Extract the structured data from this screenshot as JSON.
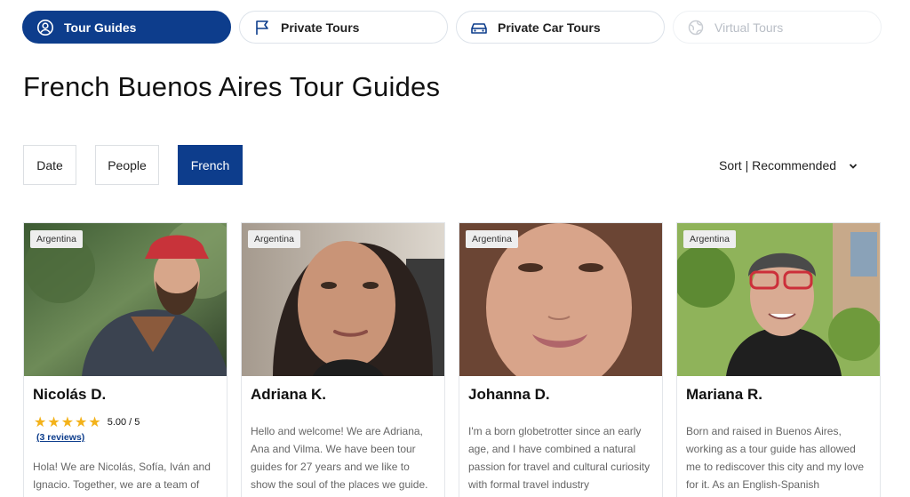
{
  "tabs": [
    {
      "label": "Tour Guides",
      "icon": "user-circle-icon",
      "active": true
    },
    {
      "label": "Private Tours",
      "icon": "flag-icon"
    },
    {
      "label": "Private Car Tours",
      "icon": "car-icon"
    },
    {
      "label": "Virtual Tours",
      "icon": "globe-icon",
      "disabled": true
    }
  ],
  "page_title": "French Buenos Aires Tour Guides",
  "filters": {
    "date": "Date",
    "people": "People",
    "language": "French"
  },
  "sort": {
    "label": "Sort | Recommended",
    "icon": "chevron-down-icon"
  },
  "colors": {
    "primary": "#0d3d8c",
    "star": "#f3b21a"
  },
  "guides": [
    {
      "country": "Argentina",
      "name": "Nicolás D.",
      "stars": "★★★★★",
      "rating": "5.00 / 5",
      "reviews": "(3 reviews)",
      "description": "Hola! We are Nicolás, Sofía, Iván and Ignacio. Together, we are a team of"
    },
    {
      "country": "Argentina",
      "name": "Adriana K.",
      "description": "Hello and welcome! We are Adriana, Ana and Vilma. We have been tour guides for 27 years and we like to show the soul of the places we guide."
    },
    {
      "country": "Argentina",
      "name": "Johanna D.",
      "description": "I'm a born globetrotter since an early age, and I have combined a natural passion for travel and cultural curiosity with formal travel industry"
    },
    {
      "country": "Argentina",
      "name": "Mariana R.",
      "description": "Born and raised in Buenos Aires, working as a tour guide has allowed me to rediscover this city and my love for it. As an English-Spanish"
    }
  ]
}
